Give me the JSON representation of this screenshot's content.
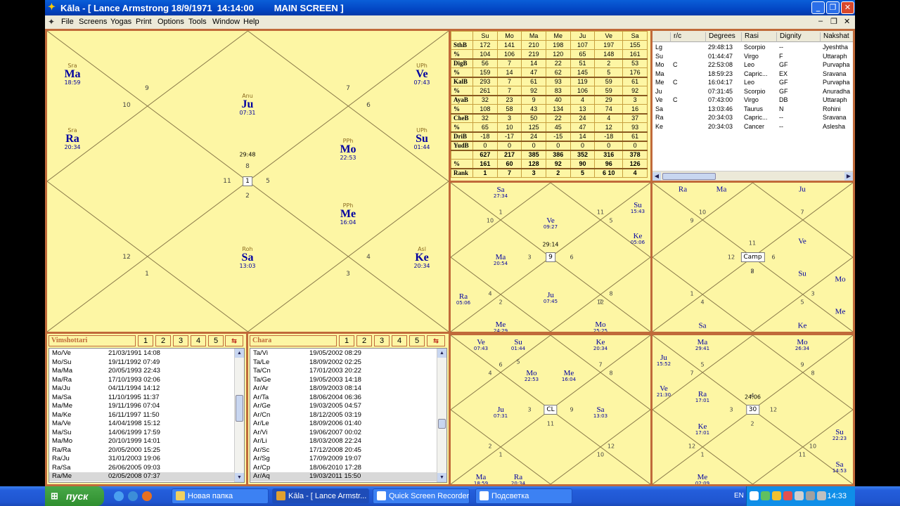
{
  "window": {
    "title": "Kāla - [ Lance Armstrong 18/9/1971  14:14:00        MAIN SCREEN ]",
    "min_label": "_",
    "max_label": "❐",
    "close_label": "✕"
  },
  "menu": [
    "File",
    "Screens",
    "Yogas",
    "Print",
    "Options",
    "Tools",
    "Window",
    "Help"
  ],
  "main_chart": {
    "center_box": "1",
    "center_time": "29:48",
    "planets": [
      {
        "nak": "Sra",
        "name": "Ma",
        "time": "18:59"
      },
      {
        "nak": "Anu",
        "name": "Ju",
        "time": "07:31"
      },
      {
        "nak": "UPh",
        "name": "Ve",
        "time": "07:43"
      },
      {
        "nak": "Sra",
        "name": "Ra",
        "time": "20:34"
      },
      {
        "nak": "PPh",
        "name": "Mo",
        "time": "22:53"
      },
      {
        "nak": "UPh",
        "name": "Su",
        "time": "01:44"
      },
      {
        "nak": "PPh",
        "name": "Me",
        "time": "16:04"
      },
      {
        "nak": "Roh",
        "name": "Sa",
        "time": "13:03"
      },
      {
        "nak": "Asl",
        "name": "Ke",
        "time": "20:34"
      }
    ],
    "houses": [
      "8",
      "9",
      "10",
      "11",
      "12",
      "1",
      "2",
      "3",
      "4",
      "5",
      "6",
      "7"
    ]
  },
  "strength": {
    "columns": [
      "",
      "Su",
      "Mo",
      "Ma",
      "Me",
      "Ju",
      "Ve",
      "Sa"
    ],
    "rows": [
      {
        "label": "SthB",
        "vals": [
          "172",
          "141",
          "210",
          "198",
          "107",
          "197",
          "155"
        ]
      },
      {
        "label": "%",
        "vals": [
          "104",
          "106",
          "219",
          "120",
          "65",
          "148",
          "161"
        ]
      },
      {
        "label": "DigB",
        "vals": [
          "56",
          "7",
          "14",
          "22",
          "51",
          "2",
          "53"
        ]
      },
      {
        "label": "%",
        "vals": [
          "159",
          "14",
          "47",
          "62",
          "145",
          "5",
          "176"
        ]
      },
      {
        "label": "KalB",
        "vals": [
          "293",
          "7",
          "61",
          "93",
          "119",
          "59",
          "61"
        ]
      },
      {
        "label": "%",
        "vals": [
          "261",
          "7",
          "92",
          "83",
          "106",
          "59",
          "92"
        ]
      },
      {
        "label": "AyaB",
        "vals": [
          "32",
          "23",
          "9",
          "40",
          "4",
          "29",
          "3"
        ]
      },
      {
        "label": "%",
        "vals": [
          "108",
          "58",
          "43",
          "134",
          "13",
          "74",
          "16"
        ]
      },
      {
        "label": "CheB",
        "vals": [
          "32",
          "3",
          "50",
          "22",
          "24",
          "4",
          "37"
        ]
      },
      {
        "label": "%",
        "vals": [
          "65",
          "10",
          "125",
          "45",
          "47",
          "12",
          "93"
        ]
      },
      {
        "label": "DriB",
        "vals": [
          "-18",
          "-17",
          "24",
          "-15",
          "14",
          "-18",
          "61"
        ]
      },
      {
        "label": "YudB",
        "vals": [
          "0",
          "0",
          "0",
          "0",
          "0",
          "0",
          "0"
        ]
      },
      {
        "label": "",
        "vals": [
          "627",
          "217",
          "385",
          "386",
          "352",
          "316",
          "378"
        ]
      },
      {
        "label": "%",
        "vals": [
          "161",
          "60",
          "128",
          "92",
          "90",
          "96",
          "126"
        ]
      },
      {
        "label": "Rank",
        "vals": [
          "1",
          "7",
          "3",
          "2",
          "5",
          "6 10",
          "4"
        ]
      }
    ]
  },
  "planet_table": {
    "headers": [
      "",
      "r/c",
      "Degrees",
      "Rasi",
      "Dignity",
      "Nakshat"
    ],
    "rows": [
      [
        "Lg",
        "",
        "29:48:13",
        "Scorpio",
        "--",
        "Jyeshtha"
      ],
      [
        "Su",
        "",
        "01:44:47",
        "Virgo",
        "F",
        "Uttaraph"
      ],
      [
        "Mo",
        "C",
        "22:53:08",
        "Leo",
        "GF",
        "Purvapha"
      ],
      [
        "Ma",
        "",
        "18:59:23",
        "Capric...",
        "EX",
        "Sravana"
      ],
      [
        "Me",
        "C",
        "16:04:17",
        "Leo",
        "GF",
        "Purvapha"
      ],
      [
        "Ju",
        "",
        "07:31:45",
        "Scorpio",
        "GF",
        "Anuradha"
      ],
      [
        "Ve",
        "C",
        "07:43:00",
        "Virgo",
        "DB",
        "Uttaraph"
      ],
      [
        "Sa",
        "",
        "13:03:46",
        "Taurus",
        "N",
        "Rohini"
      ],
      [
        "Ra",
        "",
        "20:34:03",
        "Capric...",
        "--",
        "Sravana"
      ],
      [
        "Ke",
        "",
        "20:34:03",
        "Cancer",
        "--",
        "Aslesha"
      ]
    ]
  },
  "chart_tl": {
    "center": "9",
    "center_time": "29:14",
    "labels": [
      {
        "name": "Sa",
        "time": "27:34"
      },
      {
        "name": "Su",
        "time": "15:43"
      },
      {
        "name": "Ve",
        "time": "09:27"
      },
      {
        "name": "Ke",
        "time": "05:06"
      },
      {
        "name": "Ma",
        "time": "20:54"
      },
      {
        "name": "Ra",
        "time": "05:06"
      },
      {
        "name": "Ju",
        "time": "07:45"
      },
      {
        "name": "Me",
        "time": "24:29"
      },
      {
        "name": "Mo",
        "time": "25:25"
      }
    ],
    "houses": [
      "1",
      "2",
      "11",
      "12",
      "10",
      "8",
      "3",
      "9",
      "4",
      "5",
      "7",
      "6"
    ]
  },
  "chart_tr": {
    "center": "Camp",
    "labels": [
      "Ra",
      "Ma",
      "Ju",
      "Ve",
      "Su",
      "Mo",
      "Me",
      "Sa",
      "Ke"
    ],
    "houses": [
      "10",
      "9",
      "11",
      "8",
      "7",
      "12",
      "6",
      "2",
      "1",
      "4",
      "3",
      "5"
    ]
  },
  "chart_bl": {
    "center": "CL",
    "labels": [
      {
        "name": "Ve",
        "time": "07:43"
      },
      {
        "name": "Su",
        "time": "01:44"
      },
      {
        "name": "Ke",
        "time": "20:34"
      },
      {
        "name": "Mo",
        "time": "22:53"
      },
      {
        "name": "Me",
        "time": "16:04"
      },
      {
        "name": "Ju",
        "time": "07:31"
      },
      {
        "name": "Sa",
        "time": "13:03"
      },
      {
        "name": "Ma",
        "time": "18:59"
      },
      {
        "name": "Ra",
        "time": "20:34"
      }
    ],
    "houses": [
      "6",
      "5",
      "7",
      "4",
      "8",
      "11",
      "3",
      "9",
      "12",
      "2",
      "10",
      "1"
    ]
  },
  "chart_br": {
    "center": "30",
    "center_time": "24:06",
    "labels": [
      {
        "name": "Ma",
        "time": "29:41"
      },
      {
        "name": "Mo",
        "time": "26:34"
      },
      {
        "name": "Ju",
        "time": "15:52"
      },
      {
        "name": "Ve",
        "time": "21:30"
      },
      {
        "name": "Ra",
        "time": "17:01"
      },
      {
        "name": "Ke",
        "time": "17:01"
      },
      {
        "name": "Su",
        "time": "22:23"
      },
      {
        "name": "Sa",
        "time": "14:53"
      },
      {
        "name": "Me",
        "time": "02:09"
      }
    ],
    "houses": [
      "7",
      "5",
      "8",
      "4",
      "9",
      "12",
      "3",
      "10",
      "1",
      "2",
      "11",
      "12"
    ]
  },
  "vimshottari": {
    "title": "Vimshottari",
    "levels": [
      "1",
      "2",
      "3",
      "4",
      "5"
    ],
    "rows": [
      [
        "Mo/Ve",
        "21/03/1991 14:08"
      ],
      [
        "Mo/Su",
        "19/11/1992 07:49"
      ],
      [
        "Ma/Ma",
        "20/05/1993 22:43"
      ],
      [
        "Ma/Ra",
        "17/10/1993 02:06"
      ],
      [
        "Ma/Ju",
        "04/11/1994 14:12"
      ],
      [
        "Ma/Sa",
        "11/10/1995 11:37"
      ],
      [
        "Ma/Me",
        "19/11/1996 07:04"
      ],
      [
        "Ma/Ke",
        "16/11/1997 11:50"
      ],
      [
        "Ma/Ve",
        "14/04/1998 15:12"
      ],
      [
        "Ma/Su",
        "14/06/1999 17:59"
      ],
      [
        "Ma/Mo",
        "20/10/1999 14:01"
      ],
      [
        "Ra/Ra",
        "20/05/2000 15:25"
      ],
      [
        "Ra/Ju",
        "31/01/2003 19:06"
      ],
      [
        "Ra/Sa",
        "26/06/2005 09:03"
      ],
      [
        "Ra/Me",
        "02/05/2008 07:37"
      ]
    ]
  },
  "chara": {
    "title": "Chara",
    "levels": [
      "1",
      "2",
      "3",
      "4",
      "5"
    ],
    "rows": [
      [
        "Ta/Vi",
        "19/05/2002 08:29"
      ],
      [
        "Ta/Le",
        "18/09/2002 02:25"
      ],
      [
        "Ta/Cn",
        "17/01/2003 20:22"
      ],
      [
        "Ta/Ge",
        "19/05/2003 14:18"
      ],
      [
        "Ar/Ar",
        "18/09/2003 08:14"
      ],
      [
        "Ar/Ta",
        "18/06/2004 06:36"
      ],
      [
        "Ar/Ge",
        "19/03/2005 04:57"
      ],
      [
        "Ar/Cn",
        "18/12/2005 03:19"
      ],
      [
        "Ar/Le",
        "18/09/2006 01:40"
      ],
      [
        "Ar/Vi",
        "19/06/2007 00:02"
      ],
      [
        "Ar/Li",
        "18/03/2008 22:24"
      ],
      [
        "Ar/Sc",
        "17/12/2008 20:45"
      ],
      [
        "Ar/Sg",
        "17/09/2009 19:07"
      ],
      [
        "Ar/Cp",
        "18/06/2010 17:28"
      ],
      [
        "Ar/Aq",
        "19/03/2011 15:50"
      ]
    ]
  },
  "taskbar": {
    "start": "пуск",
    "tasks": [
      "Новая папка",
      "Kāla - [ Lance Armstr...",
      "Quick Screen Recorder",
      "Подсветка"
    ],
    "lang": "EN",
    "clock": "14:33"
  }
}
